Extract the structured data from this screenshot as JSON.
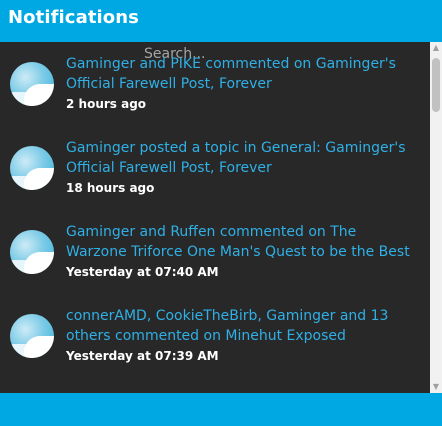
{
  "header": {
    "title": "Notifications"
  },
  "search": {
    "placeholder": "Search..."
  },
  "notifications": [
    {
      "text": "Gaminger and PIKE commented on Gaminger's Official Farewell Post, Forever",
      "time": "2 hours ago"
    },
    {
      "text": "Gaminger posted a topic in General: Gaminger's Official Farewell Post, Forever",
      "time": "18 hours ago"
    },
    {
      "text": "Gaminger and Ruffen commented on The Warzone Triforce One Man's Quest to be the Best",
      "time": "Yesterday at 07:40 AM"
    },
    {
      "text": "connerAMD, CookieTheBirb, Gaminger and 13 others commented on Minehut Exposed",
      "time": "Yesterday at 07:39 AM"
    }
  ],
  "colors": {
    "accent": "#00a8e3",
    "link": "#2fb0e6",
    "background": "#282828"
  }
}
